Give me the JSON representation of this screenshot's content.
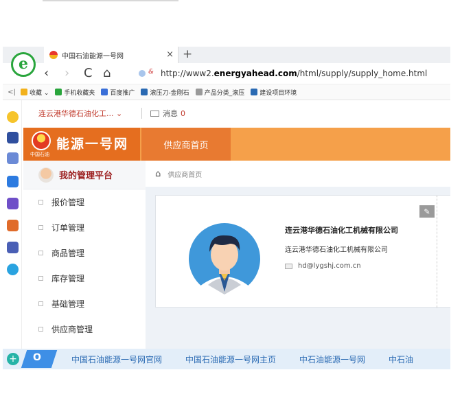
{
  "browser": {
    "tab_title": "中国石油能源一号网",
    "tab_close": "×",
    "new_tab": "+",
    "url_prefix": "http://www2.",
    "url_domain": "energyahead.com",
    "url_path": "/html/supply/supply_home.html",
    "nav": {
      "back": "‹",
      "forward": "›",
      "refresh": "C",
      "home": "⌂"
    }
  },
  "favorites": {
    "toggle": "<|",
    "items": [
      {
        "label": "收藏 ⌄",
        "icon": "star-icon",
        "color": "#f2b11b"
      },
      {
        "label": "手机收藏夹",
        "icon": "phone-icon",
        "color": "#29a53c"
      },
      {
        "label": "百度推广",
        "icon": "baidu-icon",
        "color": "#3a6fd8"
      },
      {
        "label": "滚压刀-金刚石",
        "icon": "eye-icon",
        "color": "#2a6ab3"
      },
      {
        "label": "产品分类_滚压",
        "icon": "doc-icon",
        "color": "#999999"
      },
      {
        "label": "建设项目环境",
        "icon": "globe-icon",
        "color": "#2a6ab3"
      }
    ]
  },
  "userbar": {
    "company_select": "连云港华德石油化工...  ⌄",
    "message_label": "消息",
    "message_count": "0"
  },
  "brand": {
    "name": "能源一号网",
    "sub": "中国石油"
  },
  "header": {
    "supplier_home_tab": "供应商首页"
  },
  "sidebar": {
    "title": "我的管理平台",
    "items": [
      {
        "label": "报价管理"
      },
      {
        "label": "订单管理"
      },
      {
        "label": "商品管理"
      },
      {
        "label": "库存管理"
      },
      {
        "label": "基础管理"
      },
      {
        "label": "供应商管理"
      }
    ]
  },
  "breadcrumb": {
    "label": "供应商首页"
  },
  "profile": {
    "name": "连云港华德石油化工机械有限公司",
    "company": "连云港华德石油化工机械有限公司",
    "email": "hd@lygshj.com.cn"
  },
  "bottom_links": [
    "中国石油能源一号网官网",
    "中国石油能源一号网主页",
    "中石油能源一号网",
    "中石油"
  ],
  "colors": {
    "brand_orange": "#f5a04a",
    "brand_dark_orange": "#e56e1f",
    "accent_red": "#9b1d1d",
    "link_blue": "#2a6ab3"
  }
}
